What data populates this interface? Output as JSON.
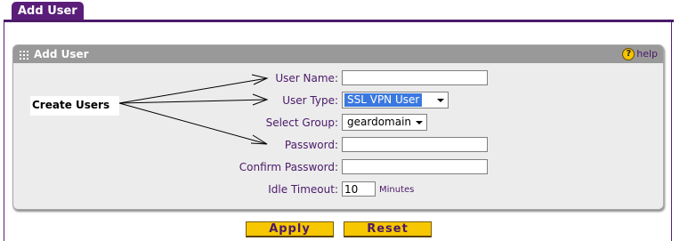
{
  "tab": {
    "label": "Add User"
  },
  "panel": {
    "title": "Add User",
    "help_label": "help",
    "help_icon": "help-icon"
  },
  "callout": {
    "text": "Create Users"
  },
  "form": {
    "user_name": {
      "label": "User Name:",
      "value": ""
    },
    "user_type": {
      "label": "User Type:",
      "value": "SSL VPN User"
    },
    "select_group": {
      "label": "Select Group:",
      "value": "geardomain"
    },
    "password": {
      "label": "Password:",
      "value": ""
    },
    "confirm_password": {
      "label": "Confirm Password:",
      "value": ""
    },
    "idle_timeout": {
      "label": "Idle Timeout:",
      "value": "10",
      "unit": "Minutes"
    }
  },
  "buttons": {
    "apply": "Apply",
    "reset": "Reset"
  },
  "colors": {
    "brand": "#5a1e7a",
    "header": "#999999",
    "button": "#f7c700",
    "label": "#4b1a6a"
  }
}
